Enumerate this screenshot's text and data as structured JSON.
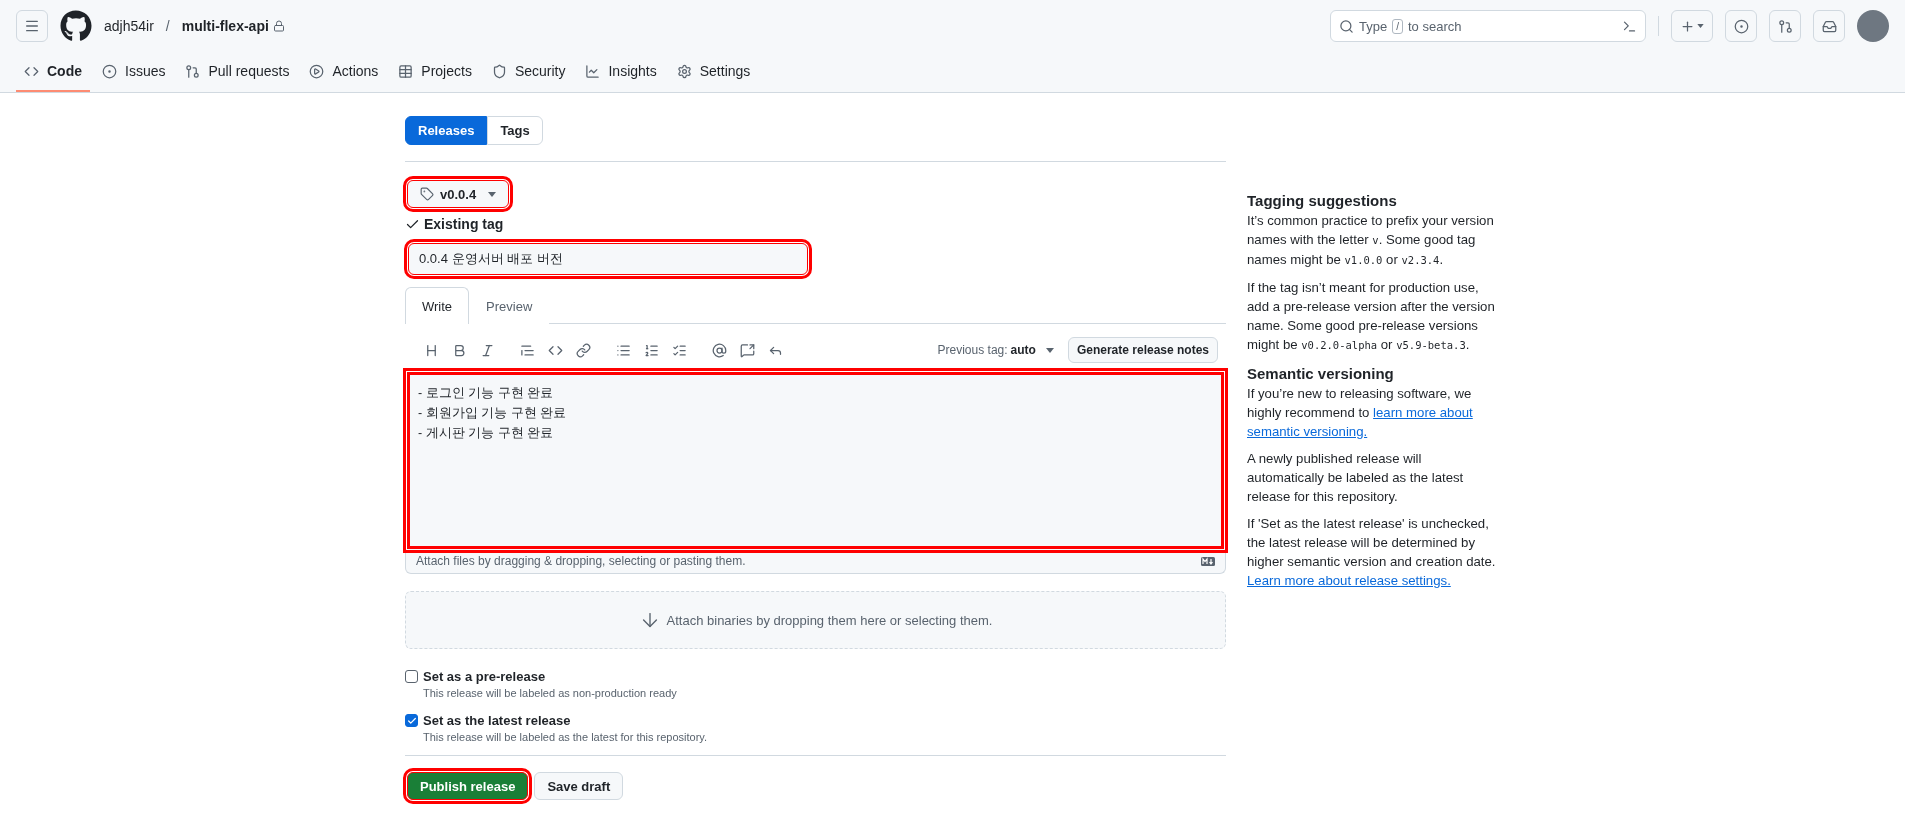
{
  "repo": {
    "owner": "adjh54ir",
    "separator": "/",
    "name": "multi-flex-api"
  },
  "search": {
    "hint": "Type",
    "key": "/",
    "hint_end": "to search"
  },
  "nav": [
    {
      "label": "Code",
      "kind": "code",
      "selected": true
    },
    {
      "label": "Issues",
      "kind": "issues",
      "selected": false
    },
    {
      "label": "Pull requests",
      "kind": "pulls",
      "selected": false
    },
    {
      "label": "Actions",
      "kind": "actions",
      "selected": false
    },
    {
      "label": "Projects",
      "kind": "projects",
      "selected": false
    },
    {
      "label": "Security",
      "kind": "security",
      "selected": false
    },
    {
      "label": "Insights",
      "kind": "insights",
      "selected": false
    },
    {
      "label": "Settings",
      "kind": "settings",
      "selected": false
    }
  ],
  "release_tabs": [
    {
      "label": "Releases",
      "selected": true
    },
    {
      "label": "Tags",
      "selected": false
    }
  ],
  "tag": {
    "label": "v0.0.4",
    "highlighted": true
  },
  "tag_status": "Existing tag",
  "title_field": {
    "value": "0.0.4 운영서버 배포 버전",
    "highlighted": true
  },
  "editor_tabs": [
    {
      "label": "Write",
      "selected": true
    },
    {
      "label": "Preview",
      "selected": false
    }
  ],
  "previous_tag": {
    "label": "Previous tag:",
    "value": "auto"
  },
  "generate_button": "Generate release notes",
  "body": {
    "highlighted": true,
    "lines": [
      "- 로그인 기능 구현 완료",
      "- 회원가입 기능 구현 완료",
      "- 게시판 기능 구현 완료"
    ]
  },
  "attach_hint": "Attach files by dragging & dropping, selecting or pasting them.",
  "binaries_hint": "Attach binaries by dropping them here or selecting them.",
  "options": [
    {
      "label": "Set as a pre-release",
      "description": "This release will be labeled as non-production ready",
      "checked": false
    },
    {
      "label": "Set as the latest release",
      "description": "This release will be labeled as the latest for this repository.",
      "checked": true
    }
  ],
  "actions": [
    {
      "label": "Publish release",
      "kind": "primary",
      "highlighted": true
    },
    {
      "label": "Save draft",
      "kind": "secondary",
      "highlighted": false
    }
  ],
  "sidebar": [
    {
      "heading": "Tagging suggestions",
      "paragraphs": [
        [
          {
            "kind": "text",
            "text": "It’s common practice to prefix your version names with the letter "
          },
          {
            "kind": "code",
            "text": "v"
          },
          {
            "kind": "text",
            "text": ". Some good tag names might be "
          },
          {
            "kind": "code",
            "text": "v1.0.0"
          },
          {
            "kind": "text",
            "text": " or "
          },
          {
            "kind": "code",
            "text": "v2.3.4"
          },
          {
            "kind": "text",
            "text": "."
          }
        ],
        [
          {
            "kind": "text",
            "text": "If the tag isn’t meant for production use, add a pre-release version after the version name. Some good pre-release versions might be "
          },
          {
            "kind": "code",
            "text": "v0.2.0-alpha"
          },
          {
            "kind": "text",
            "text": " or "
          },
          {
            "kind": "code",
            "text": "v5.9-beta.3"
          },
          {
            "kind": "text",
            "text": "."
          }
        ]
      ]
    },
    {
      "heading": "Semantic versioning",
      "paragraphs": [
        [
          {
            "kind": "text",
            "text": "If you’re new to releasing software, we highly recommend to "
          },
          {
            "kind": "link",
            "text": "learn more about"
          },
          {
            "kind": "link",
            "text": "semantic versioning."
          }
        ],
        [
          {
            "kind": "text",
            "text": "A newly published release will automatically be labeled as the latest release for this repository."
          }
        ],
        [
          {
            "kind": "text",
            "text": "If 'Set as the latest release' is unchecked, the latest release will be determined by higher semantic version and creation date. "
          },
          {
            "kind": "link",
            "text": "Learn more about release settings."
          }
        ]
      ]
    }
  ]
}
